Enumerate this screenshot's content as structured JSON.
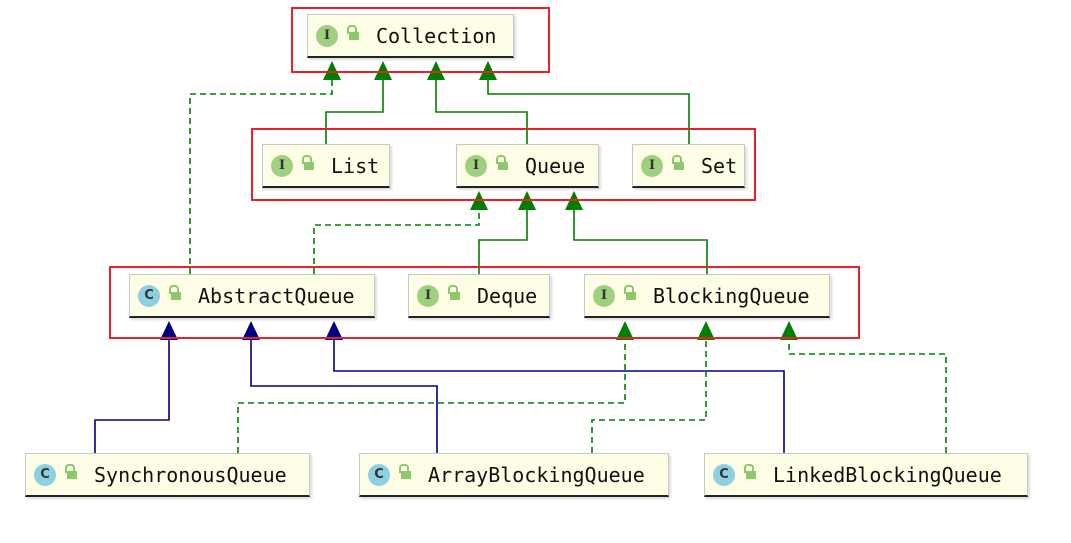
{
  "nodes": {
    "collection": {
      "label": "Collection",
      "kind": "I"
    },
    "list": {
      "label": "List",
      "kind": "I"
    },
    "queue": {
      "label": "Queue",
      "kind": "I"
    },
    "set": {
      "label": "Set",
      "kind": "I"
    },
    "abstract_queue": {
      "label": "AbstractQueue",
      "kind": "C"
    },
    "deque": {
      "label": "Deque",
      "kind": "I"
    },
    "blocking_queue": {
      "label": "BlockingQueue",
      "kind": "I"
    },
    "synchronous_queue": {
      "label": "SynchronousQueue",
      "kind": "C"
    },
    "array_blocking_queue": {
      "label": "ArrayBlockingQueue",
      "kind": "C"
    },
    "linked_blocking_queue": {
      "label": "LinkedBlockingQueue",
      "kind": "C"
    }
  },
  "colors": {
    "extends_interface": "#008000",
    "extends_class": "#000080",
    "group_border": "#e8202a",
    "node_bg": "#fefee6"
  },
  "edges": [
    {
      "from": "AbstractQueue",
      "to": "Collection",
      "style": "dashed-green"
    },
    {
      "from": "List",
      "to": "Collection",
      "style": "solid-green"
    },
    {
      "from": "Queue",
      "to": "Collection",
      "style": "solid-green"
    },
    {
      "from": "Set",
      "to": "Collection",
      "style": "solid-green"
    },
    {
      "from": "AbstractQueue",
      "to": "Queue",
      "style": "dashed-green"
    },
    {
      "from": "Deque",
      "to": "Queue",
      "style": "solid-green"
    },
    {
      "from": "BlockingQueue",
      "to": "Queue",
      "style": "solid-green"
    },
    {
      "from": "SynchronousQueue",
      "to": "AbstractQueue",
      "style": "solid-blue"
    },
    {
      "from": "ArrayBlockingQueue",
      "to": "AbstractQueue",
      "style": "solid-blue"
    },
    {
      "from": "LinkedBlockingQueue",
      "to": "AbstractQueue",
      "style": "solid-blue"
    },
    {
      "from": "SynchronousQueue",
      "to": "BlockingQueue",
      "style": "dashed-green"
    },
    {
      "from": "ArrayBlockingQueue",
      "to": "BlockingQueue",
      "style": "dashed-green"
    },
    {
      "from": "LinkedBlockingQueue",
      "to": "BlockingQueue",
      "style": "dashed-green"
    }
  ]
}
